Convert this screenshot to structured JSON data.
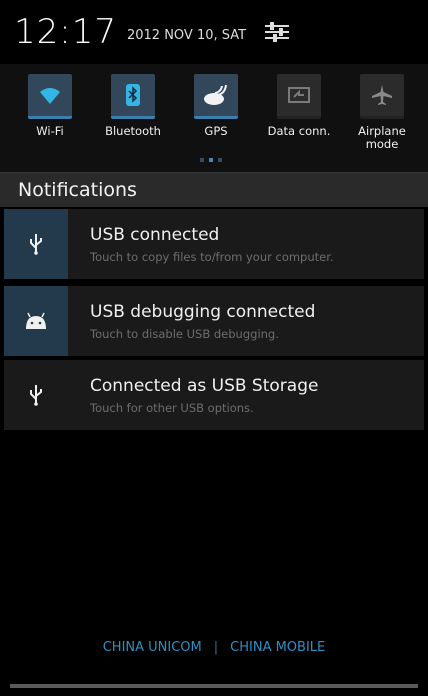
{
  "status": {
    "time": "12:17",
    "date": "2012 NOV 10, SAT"
  },
  "icons": {
    "settings": "settings-sliders-icon",
    "wifi": "wifi-icon",
    "bluetooth": "bluetooth-icon",
    "gps": "gps-icon",
    "data": "data-connection-icon",
    "airplane": "airplane-icon",
    "usb": "usb-icon",
    "android": "android-icon"
  },
  "toggles": [
    {
      "label": "Wi-Fi",
      "on": true
    },
    {
      "label": "Bluetooth",
      "on": true
    },
    {
      "label": "GPS",
      "on": true
    },
    {
      "label": "Data conn.",
      "on": false
    },
    {
      "label": "Airplane mode",
      "on": false
    }
  ],
  "notifications": {
    "header": "Notifications",
    "items": [
      {
        "title": "USB connected",
        "subtitle": "Touch to copy files to/from your computer."
      },
      {
        "title": "USB debugging connected",
        "subtitle": "Touch to disable USB debugging."
      },
      {
        "title": "Connected as USB Storage",
        "subtitle": "Touch for other USB options."
      }
    ]
  },
  "carriers": {
    "left": "CHINA UNICOM",
    "separator": "|",
    "right": "CHINA MOBILE"
  },
  "colors": {
    "accent": "#33b5e5",
    "tile_on": "#33475a",
    "background": "#000000"
  }
}
